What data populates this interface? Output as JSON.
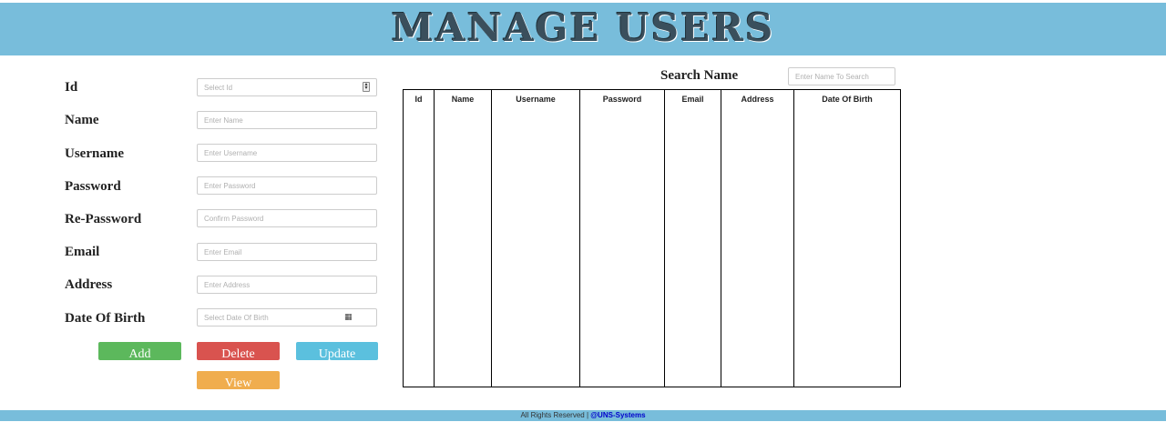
{
  "header": {
    "title": "MANAGE USERS"
  },
  "form": {
    "fields": [
      {
        "label": "Id",
        "placeholder": "Select Id"
      },
      {
        "label": "Name",
        "placeholder": "Enter Name"
      },
      {
        "label": "Username",
        "placeholder": "Enter Username"
      },
      {
        "label": "Password",
        "placeholder": "Enter Password"
      },
      {
        "label": "Re-Password",
        "placeholder": "Confirm Password"
      },
      {
        "label": "Email",
        "placeholder": "Enter Email"
      },
      {
        "label": "Address",
        "placeholder": "Enter Address"
      },
      {
        "label": "Date Of Birth",
        "placeholder": "Select Date Of Birth"
      }
    ],
    "buttons": {
      "add": "Add",
      "delete": "Delete",
      "update": "Update",
      "view": "View"
    }
  },
  "search": {
    "label": "Search Name",
    "placeholder": "Enter Name To Search"
  },
  "table": {
    "columns": [
      "Id",
      "Name",
      "Username",
      "Password",
      "Email",
      "Address",
      "Date Of Birth"
    ],
    "rows": []
  },
  "footer": {
    "text": "All Rights Reserved | ",
    "brand": "@UNS-Systems"
  },
  "colors": {
    "header_bg": "#78bddb",
    "add": "#5cb85c",
    "delete": "#d9534f",
    "update": "#5bc0de",
    "view": "#f0ad4e",
    "footer_brand": "#0000cc"
  },
  "icons": {
    "id_field": "spinner-icon",
    "dob_field": "calendar-icon"
  }
}
